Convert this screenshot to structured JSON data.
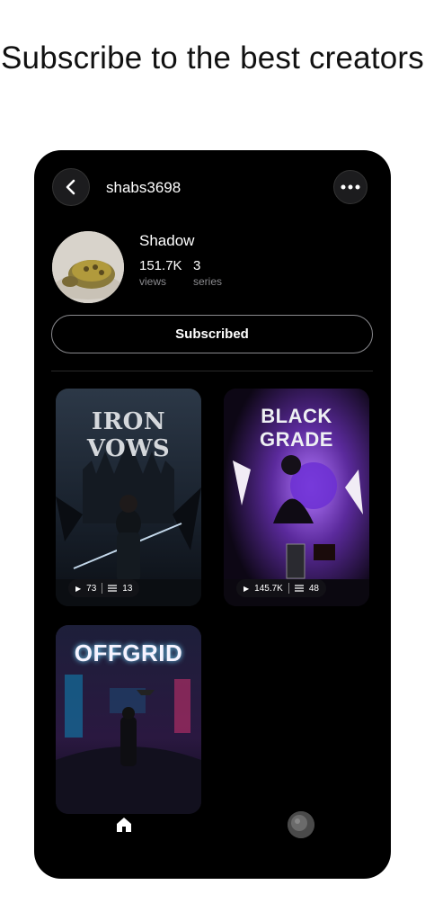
{
  "headline": "Subscribe to the best creators",
  "profile": {
    "username": "shabs3698",
    "name": "Shadow",
    "views_value": "151.7K",
    "views_label": "views",
    "series_value": "3",
    "series_label": "series"
  },
  "subscribe_label": "Subscribed",
  "cards": [
    {
      "title": "IRON VOWS",
      "views": "73",
      "episodes": "13"
    },
    {
      "title": "BLACK GRADE",
      "views": "145.7K",
      "episodes": "48"
    },
    {
      "title": "OFFGRID"
    }
  ],
  "icons": {
    "back": "chevron-left-icon",
    "more": "ellipsis-icon",
    "play": "play-icon",
    "episodes": "list-icon",
    "home": "home-icon"
  }
}
